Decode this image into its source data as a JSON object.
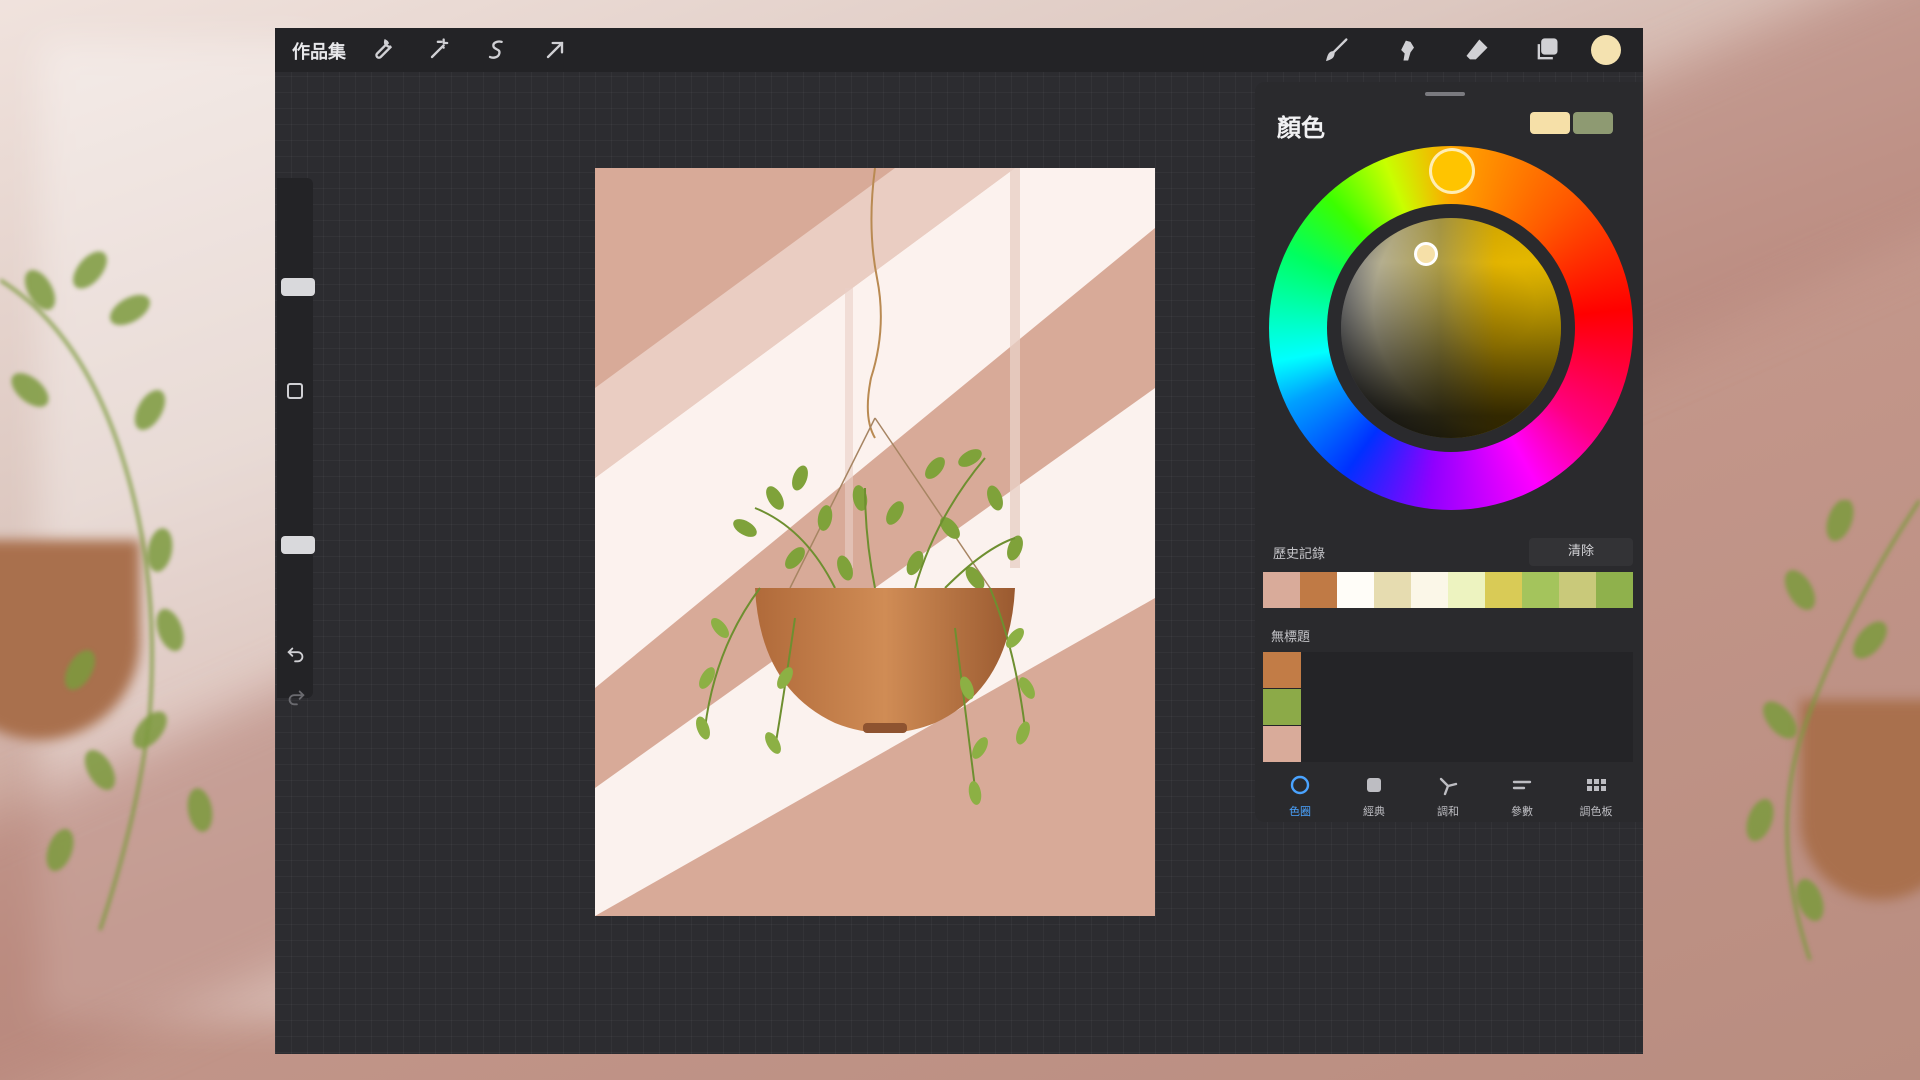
{
  "toolbar": {
    "gallery_label": "作品集",
    "left_icons": [
      "wrench-icon",
      "magic-wand-icon",
      "selection-icon",
      "transform-arrow-icon"
    ],
    "right_icons": [
      "brush-icon",
      "smudge-icon",
      "eraser-icon",
      "layers-icon"
    ],
    "current_color": "#f4e2b0"
  },
  "color_panel": {
    "title": "顏色",
    "primary_color": "#f6e0a8",
    "secondary_color": "#8e9a72",
    "history": {
      "label": "歷史記錄",
      "clear_label": "清除",
      "colors": [
        "#d9ab9a",
        "#c07a45",
        "#fffdf8",
        "#e6dcb0",
        "#fbf7e8",
        "#edf3c0",
        "#d9cb56",
        "#a4c45c",
        "#c9c97a",
        "#8fb14c"
      ]
    },
    "palette": {
      "label": "無標題",
      "colors": [
        "#c27c46",
        "#8caa48",
        "#d9ab9a"
      ]
    },
    "tabs": [
      {
        "label": "色圈",
        "icon": "color-disc-icon",
        "active": true
      },
      {
        "label": "經典",
        "icon": "classic-square-icon",
        "active": false
      },
      {
        "label": "調和",
        "icon": "harmony-icon",
        "active": false
      },
      {
        "label": "參數",
        "icon": "value-sliders-icon",
        "active": false
      },
      {
        "label": "調色板",
        "icon": "palettes-grid-icon",
        "active": false
      }
    ]
  }
}
